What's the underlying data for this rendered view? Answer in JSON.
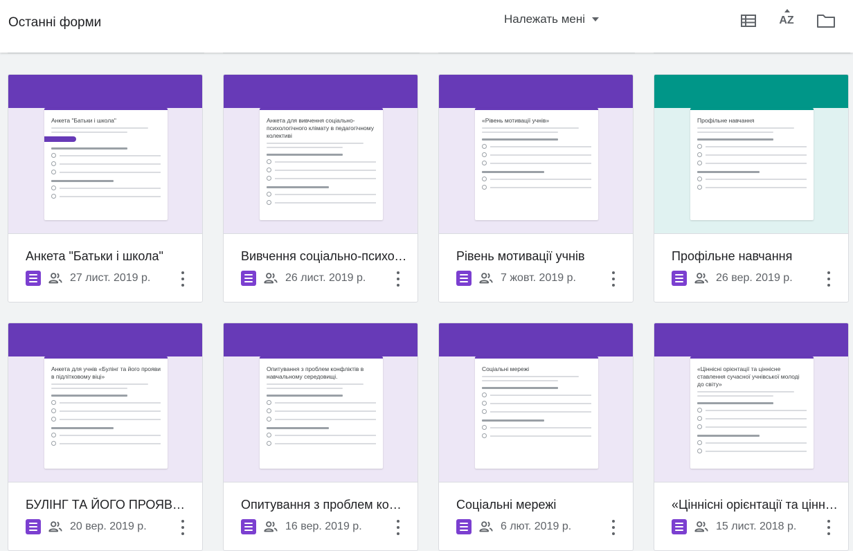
{
  "header": {
    "title": "Останні форми",
    "owner_filter": "Належать мені",
    "tools": [
      "list-view-icon",
      "sort-az-icon",
      "folder-icon"
    ],
    "sort_label": "AZ"
  },
  "colors": {
    "purple": "#673ab7",
    "purple_tint": "#ede7f6",
    "teal": "#009688",
    "teal_tint": "#e0f2f1",
    "form_icon": "#7b3fd0"
  },
  "forms": [
    {
      "name": "Анкета \"Батьки і школа\"",
      "date": "27 лист. 2019 р.",
      "theme": "purple",
      "preview_title": "Анкета \"Батьки і школа\"",
      "pill": true
    },
    {
      "name": "Вивчення соціально-психологічного клімату в педагогічному колективі",
      "date": "26 лист. 2019 р.",
      "theme": "purple",
      "preview_title": "Анкета для вивчення соціально-психологічного клімату в педагогічному колективі",
      "pill": false
    },
    {
      "name": "Рівень мотивації учнів",
      "date": "7 жовт. 2019 р.",
      "theme": "purple",
      "preview_title": "«Рівень мотивації учнів»",
      "pill": false
    },
    {
      "name": "Профільне навчання",
      "date": "26 вер. 2019 р.",
      "theme": "teal",
      "preview_title": "Профільне навчання",
      "pill": false
    },
    {
      "name": "БУЛІНГ ТА ЙОГО ПРОЯВИ В ПІДЛІТКОВОМУ ВІЦІ",
      "date": "20 вер. 2019 р.",
      "theme": "purple",
      "preview_title": "Анкета для учнів «Булінг та його прояви в підлітковому віці»",
      "pill": false
    },
    {
      "name": "Опитування з проблем конфліктів в навчальному середовищі",
      "date": "16 вер. 2019 р.",
      "theme": "purple",
      "preview_title": "Опитування з проблем конфліктів в навчальному середовищі.",
      "pill": false
    },
    {
      "name": "Соціальні мережі",
      "date": "6 лют. 2019 р.",
      "theme": "purple",
      "preview_title": "Соціальні мережі",
      "pill": false
    },
    {
      "name": "«Ціннісні орієнтації та ціннісне ставлення сучасної учнівської молоді до світу»",
      "date": "15 лист. 2018 р.",
      "theme": "purple",
      "preview_title": "«Ціннісні орієнтації та ціннісне ставлення сучасної учнівської молоді до світу»",
      "pill": false
    }
  ]
}
